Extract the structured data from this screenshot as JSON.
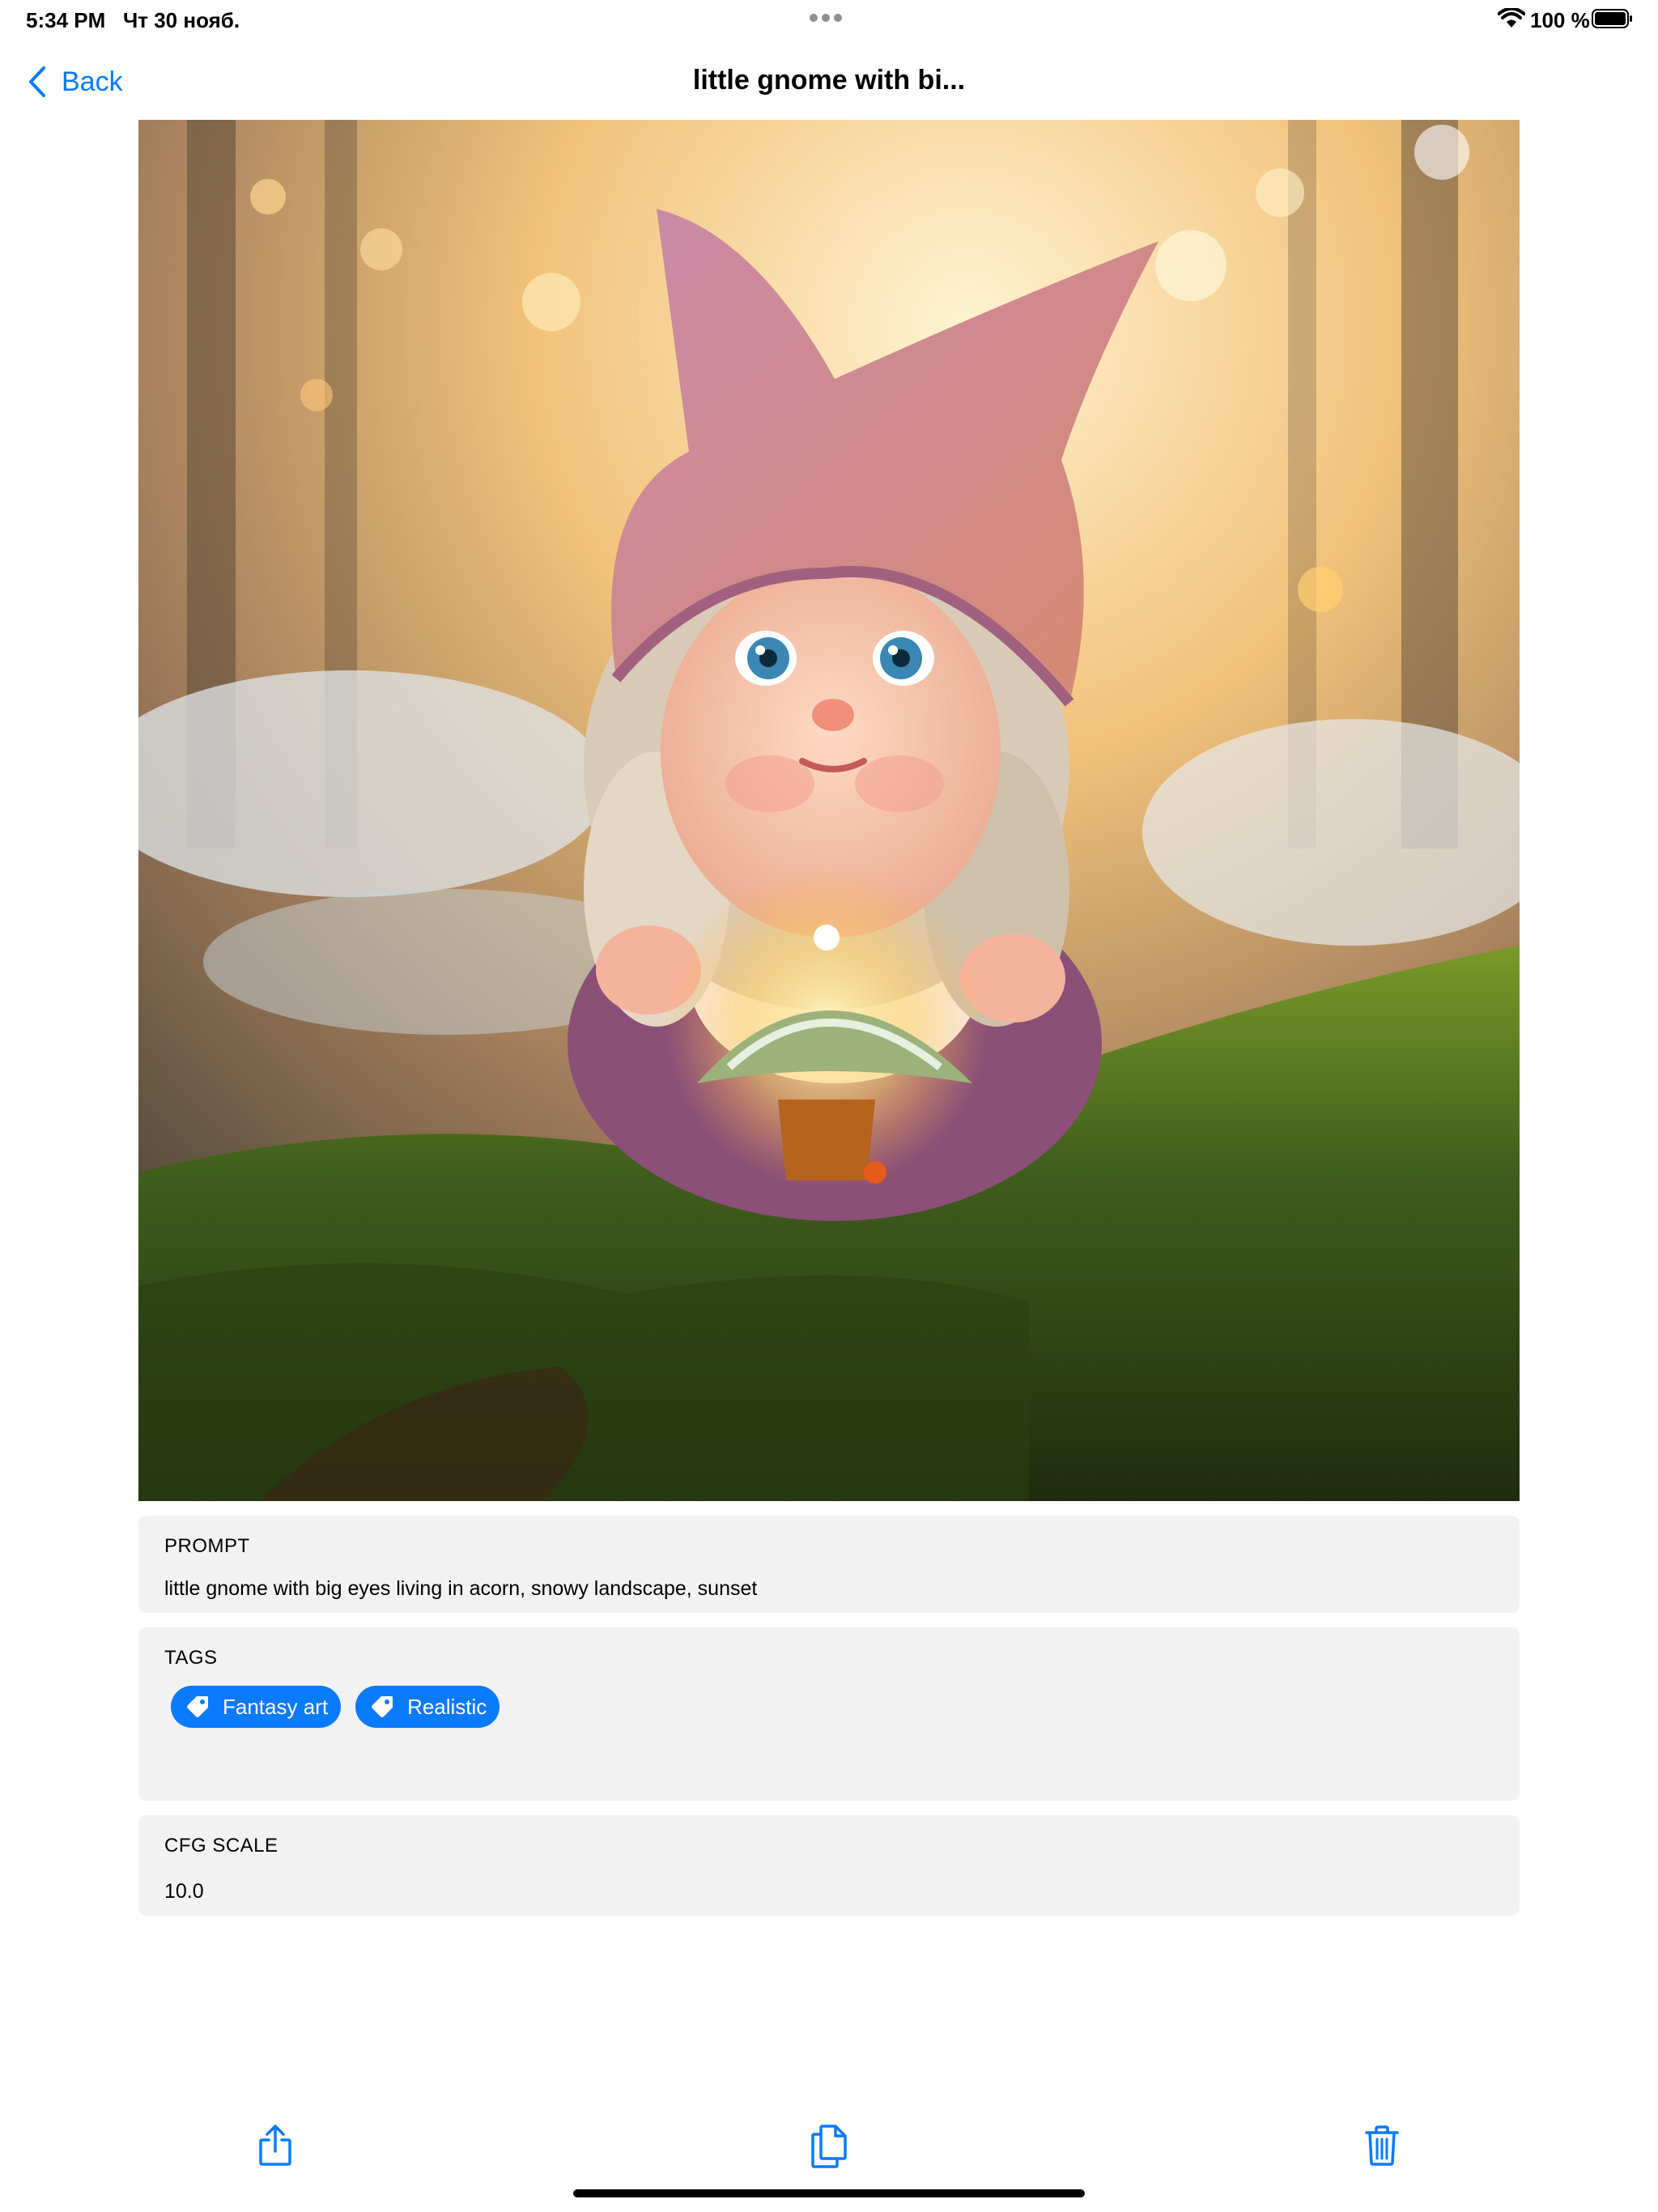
{
  "status_bar": {
    "time": "5:34 PM",
    "date": "Чт 30 нояб.",
    "battery_percent": "100 %"
  },
  "nav": {
    "back_label": "Back",
    "title": "little gnome with bi..."
  },
  "colors": {
    "accent": "#0a7aff",
    "card_background": "#f2f2f2"
  },
  "prompt": {
    "label": "PROMPT",
    "value": "little gnome with big eyes living in acorn, snowy landscape, sunset"
  },
  "tags": {
    "label": "TAGS",
    "items": [
      {
        "label": "Fantasy art",
        "icon": "tag-icon"
      },
      {
        "label": "Realistic",
        "icon": "tag-icon"
      }
    ]
  },
  "cfg_scale": {
    "label": "CFG SCALE",
    "value": "10.0"
  },
  "toolbar": {
    "icons": [
      "share-icon",
      "copy-icon",
      "trash-icon"
    ]
  }
}
